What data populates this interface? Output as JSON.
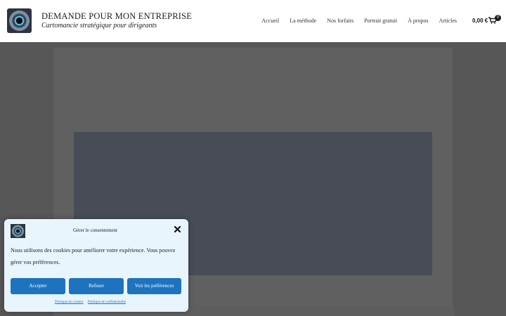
{
  "header": {
    "site_title": "DEMANDE POUR MON ENTREPRISE",
    "tagline": "Cartomancie stratégique pour dirigeants",
    "nav": [
      "Accueil",
      "La méthode",
      "Nos forfaits",
      "Portrait gratuit",
      "À propos",
      "Articles"
    ],
    "cart_total": "0,00 €",
    "cart_count": "0"
  },
  "cookie": {
    "title": "Gérer le consentement",
    "text": "Nous utilisons des cookies pour améliorer votre expérience. Vous pouvez gérer vos préférences.",
    "accept": "Accepter",
    "refuse": "Refuser",
    "preferences": "Voir les préférences",
    "links": [
      "Politique de cookies",
      "Politique de confidentialité"
    ]
  },
  "colors": {
    "overlay": "#575757",
    "button": "#1e73be",
    "dialog_bg": "#e8f5fd"
  }
}
